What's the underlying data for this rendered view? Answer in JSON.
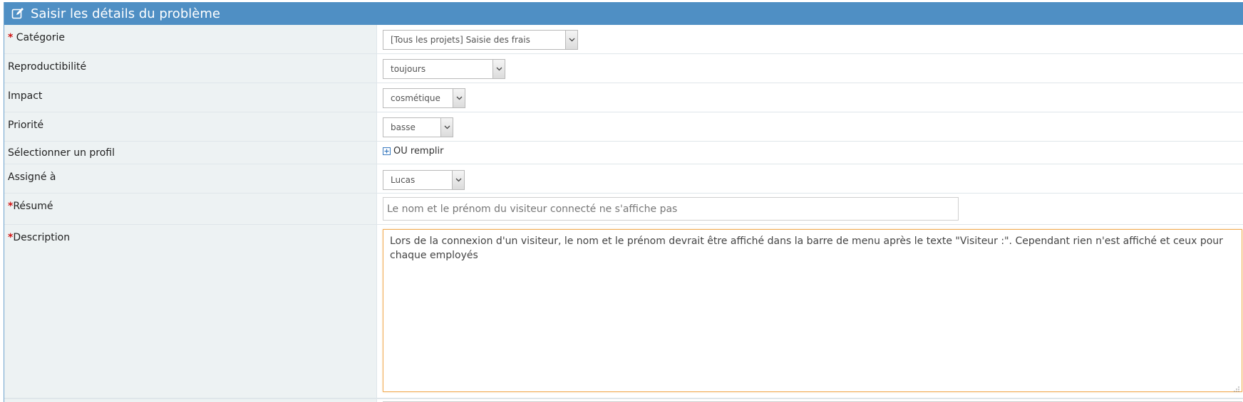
{
  "header": {
    "title": "Saisir les détails du problème",
    "icon": "edit-icon"
  },
  "form": {
    "required_marker": "*",
    "category": {
      "label": "Catégorie",
      "value": "[Tous les projets] Saisie des frais"
    },
    "reproducibility": {
      "label": "Reproductibilité",
      "value": "toujours"
    },
    "impact": {
      "label": "Impact",
      "value": "cosmétique"
    },
    "priority": {
      "label": "Priorité",
      "value": "basse"
    },
    "profile": {
      "label": "Sélectionner un profil",
      "link": "OU remplir",
      "icon": "plus-square-icon"
    },
    "assigned": {
      "label": "Assigné à",
      "value": "Lucas"
    },
    "summary": {
      "label": "Résumé",
      "value": "Le nom et le prénom du visiteur connecté ne s'affiche pas"
    },
    "description": {
      "label": "Description",
      "value": "Lors de la connexion d'un visiteur, le nom et le prénom devrait être affiché dans la barre de menu après le texte \"Visiteur :\". Cependant rien n'est affiché et ceux  pour chaque employés"
    }
  },
  "colors": {
    "header_bg": "#4f8fc4",
    "label_bg": "#edf2f3",
    "required": "#d01414",
    "focus_border": "#f1ac55"
  }
}
